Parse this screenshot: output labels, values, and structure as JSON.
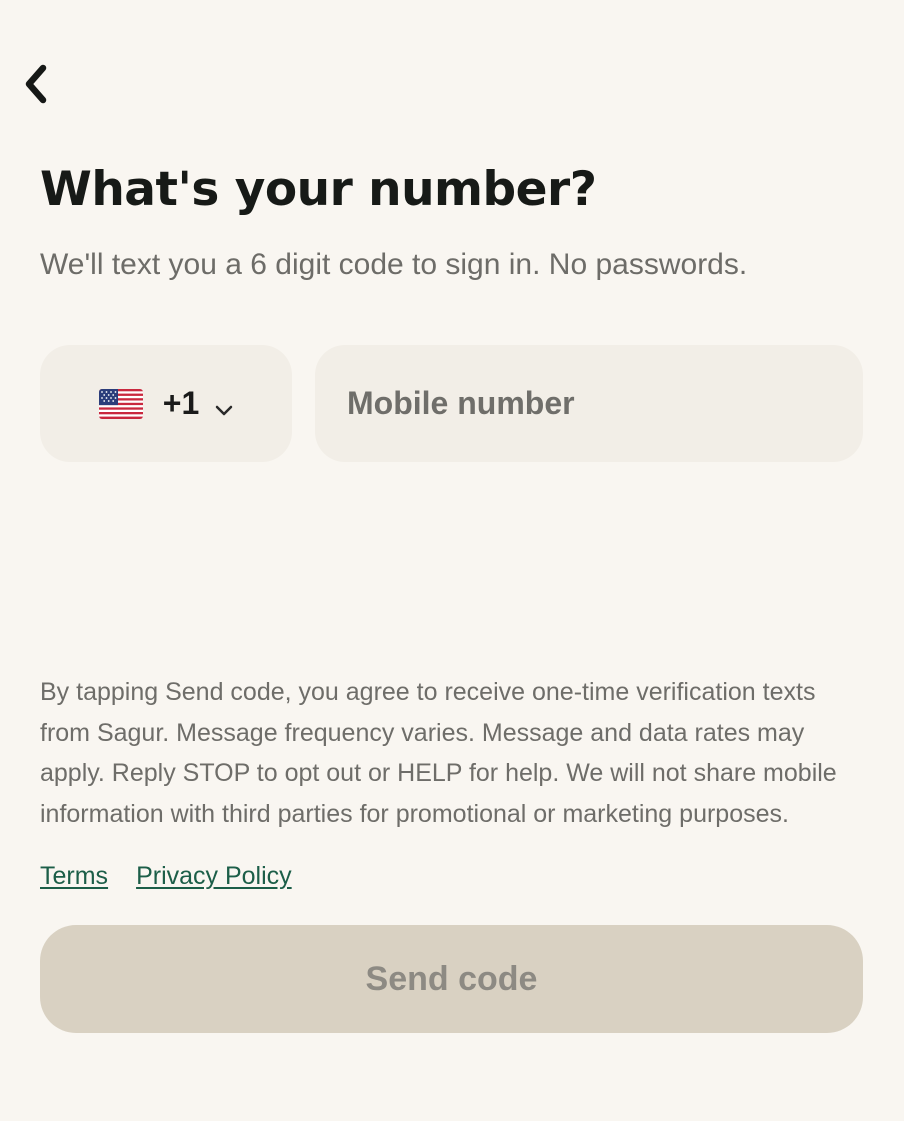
{
  "header": {
    "back_icon": "chevron-left-icon"
  },
  "page": {
    "title": "What's your number?",
    "subtitle": "We'll text you a 6 digit code to sign in. No passwords."
  },
  "phone": {
    "country_flag": "us-flag-icon",
    "dial_code": "+1",
    "dropdown_icon": "chevron-down-icon",
    "value": "",
    "placeholder": "Mobile number"
  },
  "legal": {
    "text": "By tapping Send code, you agree to receive one-time verification texts from Sagur. Message frequency varies. Message and data rates may apply. Reply STOP to opt out or HELP for help. We will not share mobile information with third parties for promotional or marketing purposes.",
    "terms_label": "Terms",
    "privacy_label": "Privacy Policy"
  },
  "actions": {
    "send_label": "Send code"
  },
  "colors": {
    "background": "#f9f6f1",
    "input_background": "#f2eee7",
    "link": "#1c5e48",
    "button_disabled": "#d9d1c2",
    "button_text_disabled": "#8d8a83"
  }
}
